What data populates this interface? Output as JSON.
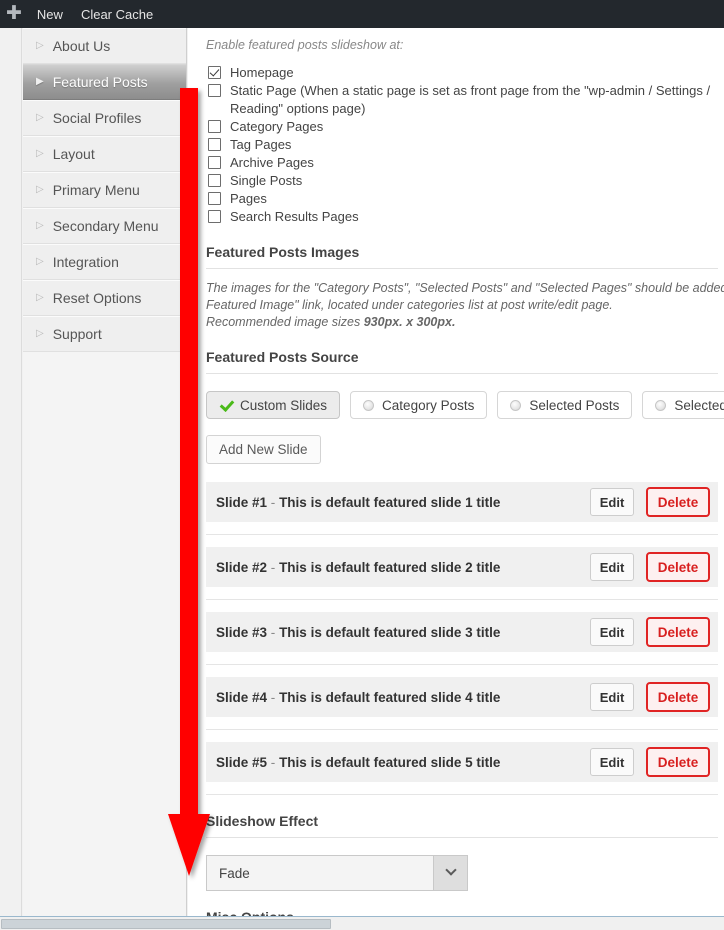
{
  "adminbar": {
    "new_icon": "plus-icon",
    "new_label": "New",
    "clear_cache_label": "Clear Cache"
  },
  "sidebar": {
    "items": [
      {
        "label": "About Us",
        "active": false
      },
      {
        "label": "Featured Posts",
        "active": true
      },
      {
        "label": "Social Profiles",
        "active": false
      },
      {
        "label": "Layout",
        "active": false
      },
      {
        "label": "Primary Menu",
        "active": false
      },
      {
        "label": "Secondary Menu",
        "active": false
      },
      {
        "label": "Integration",
        "active": false
      },
      {
        "label": "Reset Options",
        "active": false
      },
      {
        "label": "Support",
        "active": false
      }
    ]
  },
  "main": {
    "enable_hint": "Enable featured posts slideshow at:",
    "checkboxes": [
      {
        "label": "Homepage",
        "checked": true
      },
      {
        "label": "Static Page (When a static page is set as front page from the \"wp-admin / Settings / Reading\" options page)",
        "checked": false
      },
      {
        "label": "Category Pages",
        "checked": false
      },
      {
        "label": "Tag Pages",
        "checked": false
      },
      {
        "label": "Archive Pages",
        "checked": false
      },
      {
        "label": "Single Posts",
        "checked": false
      },
      {
        "label": "Pages",
        "checked": false
      },
      {
        "label": "Search Results Pages",
        "checked": false
      }
    ],
    "images_section": {
      "title": "Featured Posts Images",
      "line1": "The images for the \"Category Posts\", \"Selected Posts\" and \"Selected Pages\" should be added from \"Set",
      "line2": "Featured Image\" link, located under categories list at post write/edit page.",
      "line3_prefix": "Recommended image sizes ",
      "line3_bold": "930px. x 300px."
    },
    "source_section": {
      "title": "Featured Posts Source",
      "options": [
        {
          "label": "Custom Slides",
          "selected": true
        },
        {
          "label": "Category Posts",
          "selected": false
        },
        {
          "label": "Selected Posts",
          "selected": false
        },
        {
          "label": "Selected Pages",
          "selected": false
        }
      ],
      "add_slide_label": "Add New Slide"
    },
    "slides": [
      {
        "name": "Slide #1",
        "separator": "-",
        "title": "This is default featured slide 1 title",
        "edit_label": "Edit",
        "delete_label": "Delete"
      },
      {
        "name": "Slide #2",
        "separator": "-",
        "title": "This is default featured slide 2 title",
        "edit_label": "Edit",
        "delete_label": "Delete"
      },
      {
        "name": "Slide #3",
        "separator": "-",
        "title": "This is default featured slide 3 title",
        "edit_label": "Edit",
        "delete_label": "Delete"
      },
      {
        "name": "Slide #4",
        "separator": "-",
        "title": "This is default featured slide 4 title",
        "edit_label": "Edit",
        "delete_label": "Delete"
      },
      {
        "name": "Slide #5",
        "separator": "-",
        "title": "This is default featured slide 5 title",
        "edit_label": "Edit",
        "delete_label": "Delete"
      }
    ],
    "effect_section": {
      "title": "Slideshow Effect",
      "selected_value": "Fade",
      "chevron_icon": "chevron-down-icon"
    },
    "misc_section": {
      "title": "Misc Options"
    }
  },
  "annotation": {
    "arrow_icon": "down-arrow-annotation",
    "color": "#ff0000"
  },
  "colors": {
    "adminbar_bg": "#23282d",
    "accent_red": "#ff0000",
    "delete_red": "#d81f1f",
    "check_green": "#4aba19"
  }
}
